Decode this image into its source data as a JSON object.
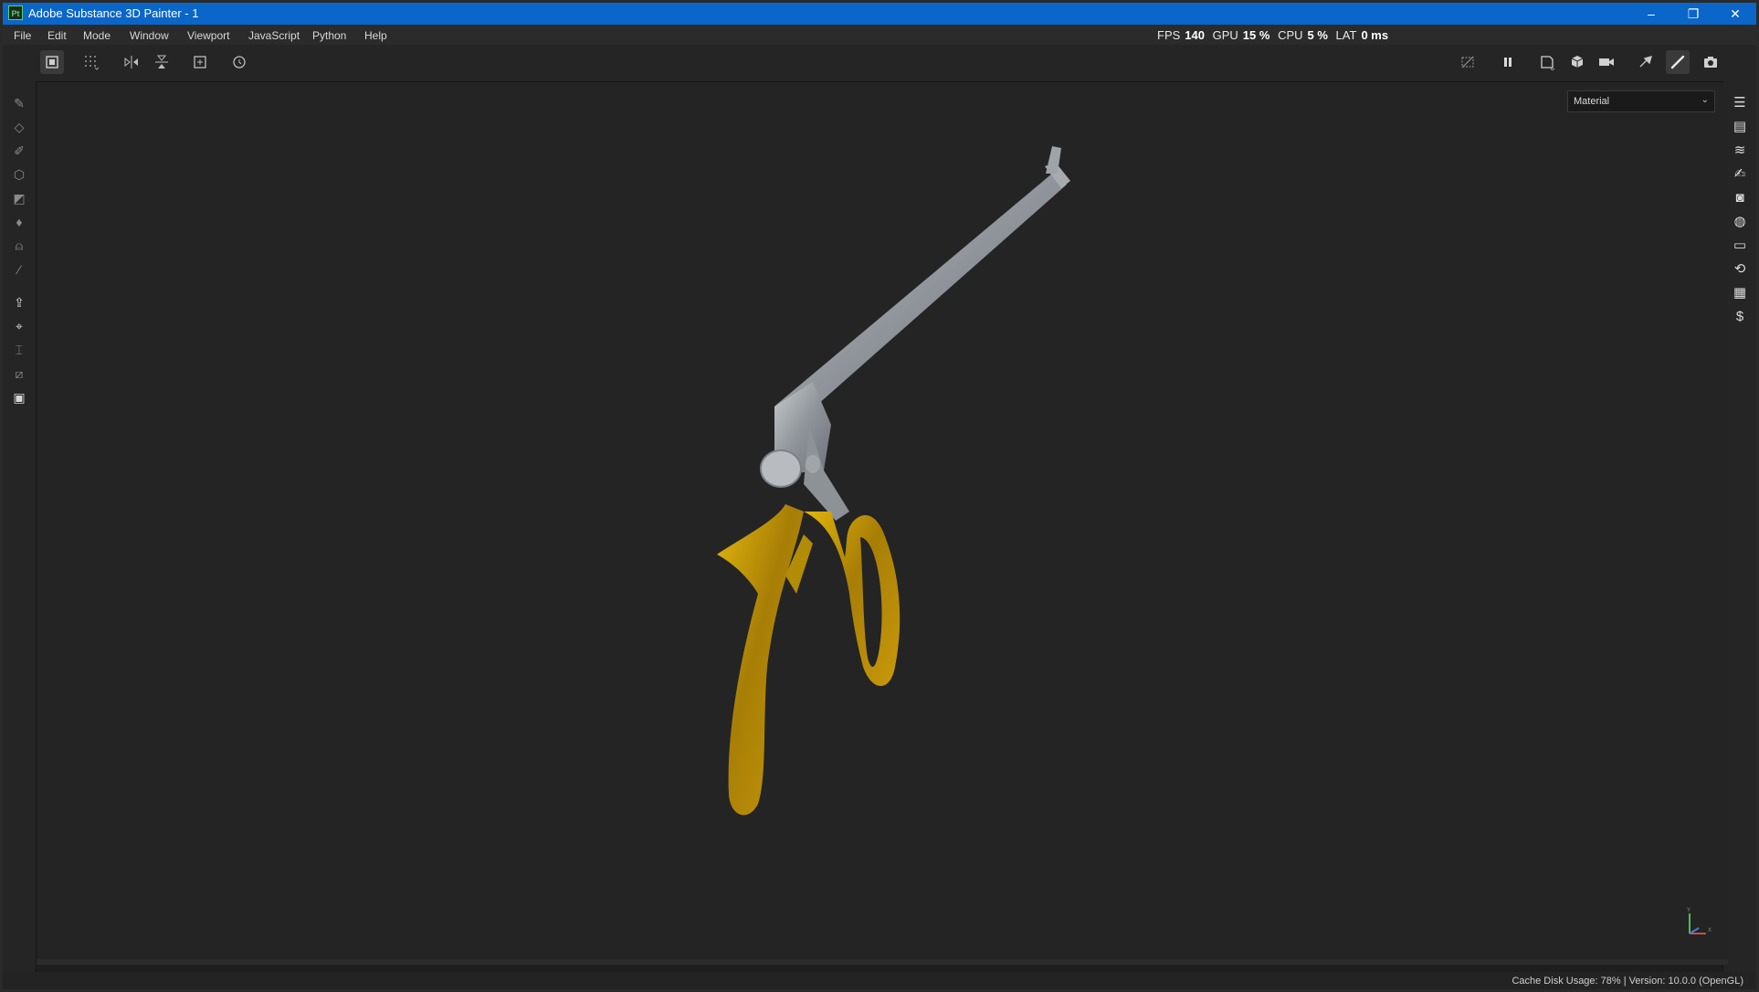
{
  "window": {
    "title": "Adobe Substance 3D Painter - 1",
    "app_icon_text": "Pt",
    "controls": {
      "minimize": "–",
      "restore": "❐",
      "close": "✕"
    }
  },
  "menu": [
    "File",
    "Edit",
    "Mode",
    "Window",
    "Viewport",
    "JavaScript",
    "Python",
    "Help"
  ],
  "stats": {
    "fps_label": "FPS",
    "fps_value": "140",
    "gpu_label": "GPU",
    "gpu_value": "15 %",
    "cpu_label": "CPU",
    "cpu_value": "5 %",
    "lat_label": "LAT",
    "lat_value": "0 ms"
  },
  "toolbar": {
    "left_icons": [
      "selection-mode-icon",
      "grid-snap-icon",
      "symmetry-x-icon",
      "symmetry-y-icon",
      "frame-add-icon",
      "reset-history-icon"
    ],
    "right_icons": [
      "hide-icon",
      "pause-icon",
      "view-2d-icon",
      "view-3d-icon",
      "camera-icon",
      "brush-settings-icon",
      "paint-icon",
      "screenshot-icon"
    ]
  },
  "viewport": {
    "channel_select": "Material",
    "background": "#242424",
    "model_colors": {
      "steel": "#9ea3a8",
      "gold": "#c79a07"
    },
    "axis_labels": {
      "y": "Y",
      "x": "X"
    }
  },
  "status": {
    "text": "Cache Disk Usage:    78% | Version: 10.0.0 (OpenGL)"
  },
  "colors": {
    "titlebar": "#0a66c8",
    "accent_green": "#59d16f"
  }
}
